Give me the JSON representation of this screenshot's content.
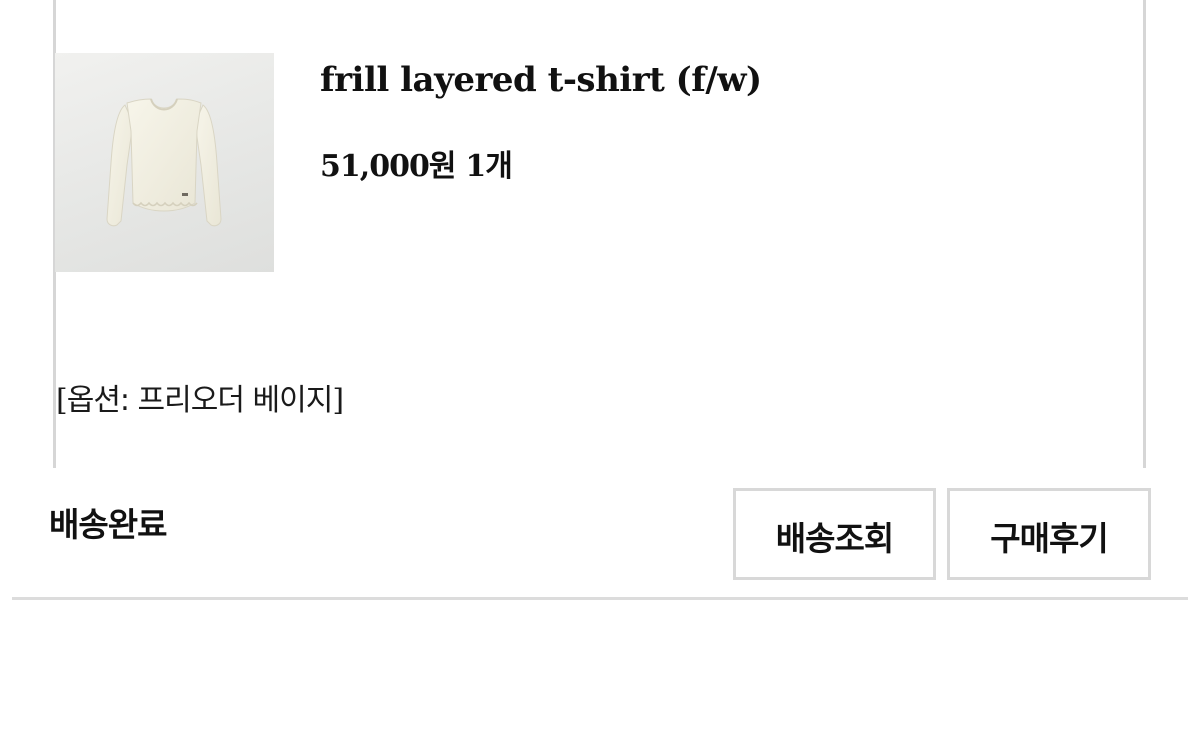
{
  "order_item": {
    "product_name": "frill layered t-shirt (f/w)",
    "price": "51,000원",
    "quantity": "1개",
    "option_text": "옵션: 프리오더 베이지",
    "option_open_bracket": "[",
    "option_close_bracket": "]",
    "thumbnail_icon": "cream-long-sleeve-tshirt-image"
  },
  "delivery": {
    "status": "배송완료"
  },
  "actions": {
    "track_label": "배송조회",
    "review_label": "구매후기"
  },
  "colors": {
    "text": "#111111",
    "border": "#d8d8d8",
    "garment": "#f3f0e2"
  }
}
